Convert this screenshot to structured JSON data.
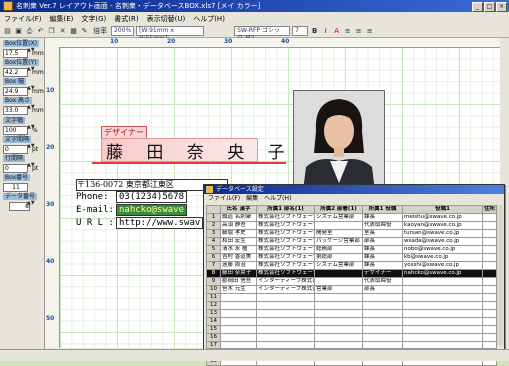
{
  "window": {
    "title": "名刺衆 Ver.7 レイアウト画面 - 名刺衆・データベースBOX.xls7 [メイ カラー]"
  },
  "menubar": [
    "ファイル(F)",
    "編集(E)",
    "文字(G)",
    "書式(R)",
    "表示切替(U)",
    "ヘルプ(H)"
  ],
  "toolbar": {
    "zoom_label": "倍率",
    "zoom_value": "200%",
    "size_readout": "[W:91mm x H:55mm]",
    "font_value": "SW-RFP ゴシック-M2",
    "font_size": "7"
  },
  "side": {
    "box_x_label": "Box位置(X)",
    "box_x_value": "17.5",
    "box_x_unit": "mm",
    "box_y_label": "Box位置(Y)",
    "box_y_value": "42.2",
    "box_y_unit": "mm",
    "box_w_label": "Box 幅",
    "box_w_value": "24.9",
    "box_w_unit": "mm",
    "box_h_label": "Box 高さ",
    "box_h_value": "33.0",
    "box_h_unit": "mm",
    "char_scale_label": "文字幅",
    "char_scale_value": "100",
    "char_scale_unit": "%",
    "char_spacing_label": "文字間隔",
    "char_spacing_value": "0",
    "char_spacing_unit": "pt",
    "line_spacing_label": "行間隔",
    "line_spacing_value": "0",
    "line_spacing_unit": "pt",
    "box_number_label": "Box番号",
    "box_number_value": "11",
    "data_number_label": "データ番号",
    "data_number_value": "8"
  },
  "ruler": {
    "top": [
      "10",
      "20",
      "30",
      "40"
    ],
    "left": [
      "10",
      "20",
      "30",
      "40",
      "50"
    ]
  },
  "card": {
    "title_tag": "デザイナー",
    "name": "藤 田 奈 央 子",
    "address": "〒136-0072 東京都江東区",
    "phone_label": "Phone:",
    "phone_value": "03(1234)5678",
    "email_label": "E-mail:",
    "email_value": "nahcko@swave",
    "url_label": "U R L :",
    "url_value": "http://www.swav"
  },
  "dialog": {
    "title": "データベース設定",
    "menu": [
      "ファイル(F)",
      "編集",
      "ヘルプ(H)"
    ],
    "columns": [
      "",
      "氏名 漢字",
      "所属1 部名(1)",
      "所属2 部署(1)",
      "所属1 役職",
      "役職1",
      "住所1 E-mail",
      "住"
    ],
    "rows": [
      [
        "1",
        "誠道 名刺衆",
        "株式会社ソフトウェーブ",
        "システム営業部",
        "課長",
        "meishu@swave.co.jp",
        ""
      ],
      [
        "2",
        "高須 静吾",
        "株式会社ソフトウェーブ",
        "",
        "代表取締役",
        "kaoyan@swave.co.jp",
        ""
      ],
      [
        "3",
        "藤堀 孝史",
        "株式会社ソフトウェーブ",
        "開発室",
        "室長",
        "tursan@swave.co.jp",
        ""
      ],
      [
        "4",
        "和田 宏生",
        "株式会社ソフトウェーブ",
        "パッケージ営業部",
        "部長",
        "wsada@swave.co.jp",
        ""
      ],
      [
        "5",
        "清水 永 檀",
        "株式会社ソフトウェーブ",
        "総務部",
        "課長",
        "nobo@swave.co.jp",
        ""
      ],
      [
        "6",
        "吉村 香道美",
        "株式会社ソフトウェーブ",
        "第総部",
        "課長",
        "kb@swave.co.jp",
        ""
      ],
      [
        "7",
        "遠藤 周治",
        "株式会社ソフトウェーブ",
        "システム営業部",
        "課長",
        "yosshi@swave.co.jp",
        ""
      ],
      [
        "8",
        "藤田 奈央子",
        "株式会社ソフトウェーブ",
        "",
        "デザイナー",
        "nahcko@swave.co.jp",
        ""
      ],
      [
        "9",
        "郡岡田 信吾",
        "インターディーブ株式会社",
        "",
        "代表取締役",
        "",
        ""
      ],
      [
        "10",
        "笹木 元生",
        "インターディーブ株式会社",
        "営業部",
        "部長",
        "",
        ""
      ],
      [
        "11",
        "",
        "",
        "",
        "",
        "",
        ""
      ],
      [
        "12",
        "",
        "",
        "",
        "",
        "",
        ""
      ],
      [
        "13",
        "",
        "",
        "",
        "",
        "",
        ""
      ],
      [
        "14",
        "",
        "",
        "",
        "",
        "",
        ""
      ],
      [
        "15",
        "",
        "",
        "",
        "",
        "",
        ""
      ],
      [
        "16",
        "",
        "",
        "",
        "",
        "",
        ""
      ],
      [
        "17",
        "",
        "",
        "",
        "",
        "",
        ""
      ],
      [
        "18",
        "",
        "",
        "",
        "",
        "",
        ""
      ],
      [
        "19",
        "",
        "",
        "",
        "",
        "",
        ""
      ]
    ],
    "selected_row": 7
  },
  "colors": {
    "accent": "#0a2a8a",
    "card_highlight": "#f7c9c9",
    "email_bg": "#3c8a3c",
    "grid": "#c9e6c0"
  }
}
